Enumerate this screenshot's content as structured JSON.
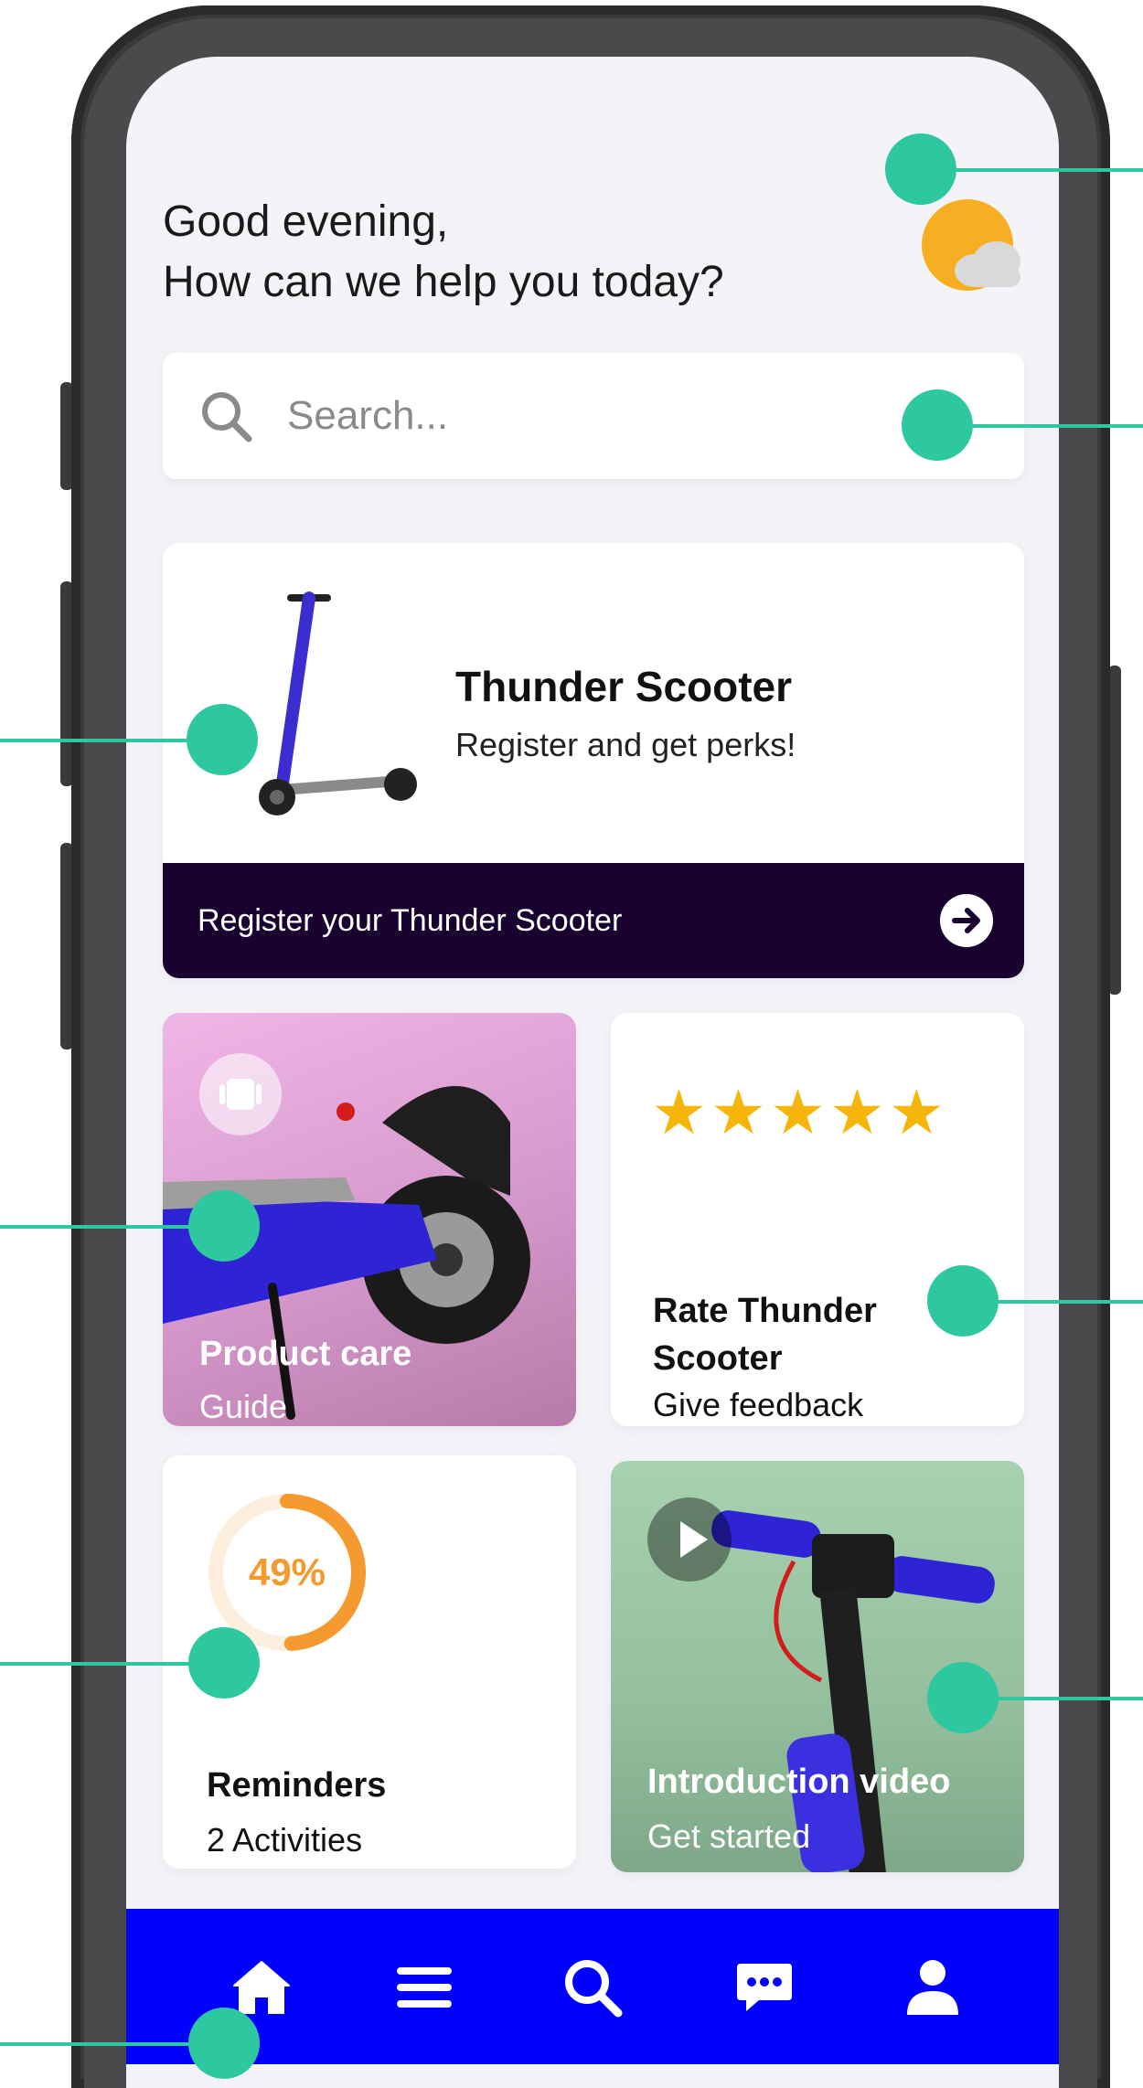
{
  "greeting": {
    "line1": "Good evening,",
    "line2": "How can we help you today?"
  },
  "weather": {
    "icon": "weather-sun-cloud-icon"
  },
  "search": {
    "placeholder": "Search..."
  },
  "promo": {
    "title": "Thunder Scooter",
    "subtitle": "Register and get perks!",
    "cta_label": "Register your Thunder Scooter"
  },
  "cards": {
    "product_care": {
      "title": "Product care",
      "subtitle": "Guide"
    },
    "rate": {
      "title": "Rate Thunder Scooter",
      "subtitle": "Give feedback",
      "stars": 5
    },
    "reminders": {
      "percent_label": "49%",
      "progress": 0.49,
      "title": "Reminders",
      "subtitle": "2 Activities"
    },
    "video": {
      "title": "Introduction video",
      "subtitle": "Get started"
    }
  },
  "tabbar": {
    "items": [
      "home-icon",
      "menu-icon",
      "search-icon",
      "chat-icon",
      "profile-icon"
    ]
  },
  "colors": {
    "accent_dark": "#19022f",
    "tabbar": "#0000ff",
    "annotation": "#2ec8a0",
    "star": "#f5b50a",
    "progress": "#f59a2e"
  }
}
